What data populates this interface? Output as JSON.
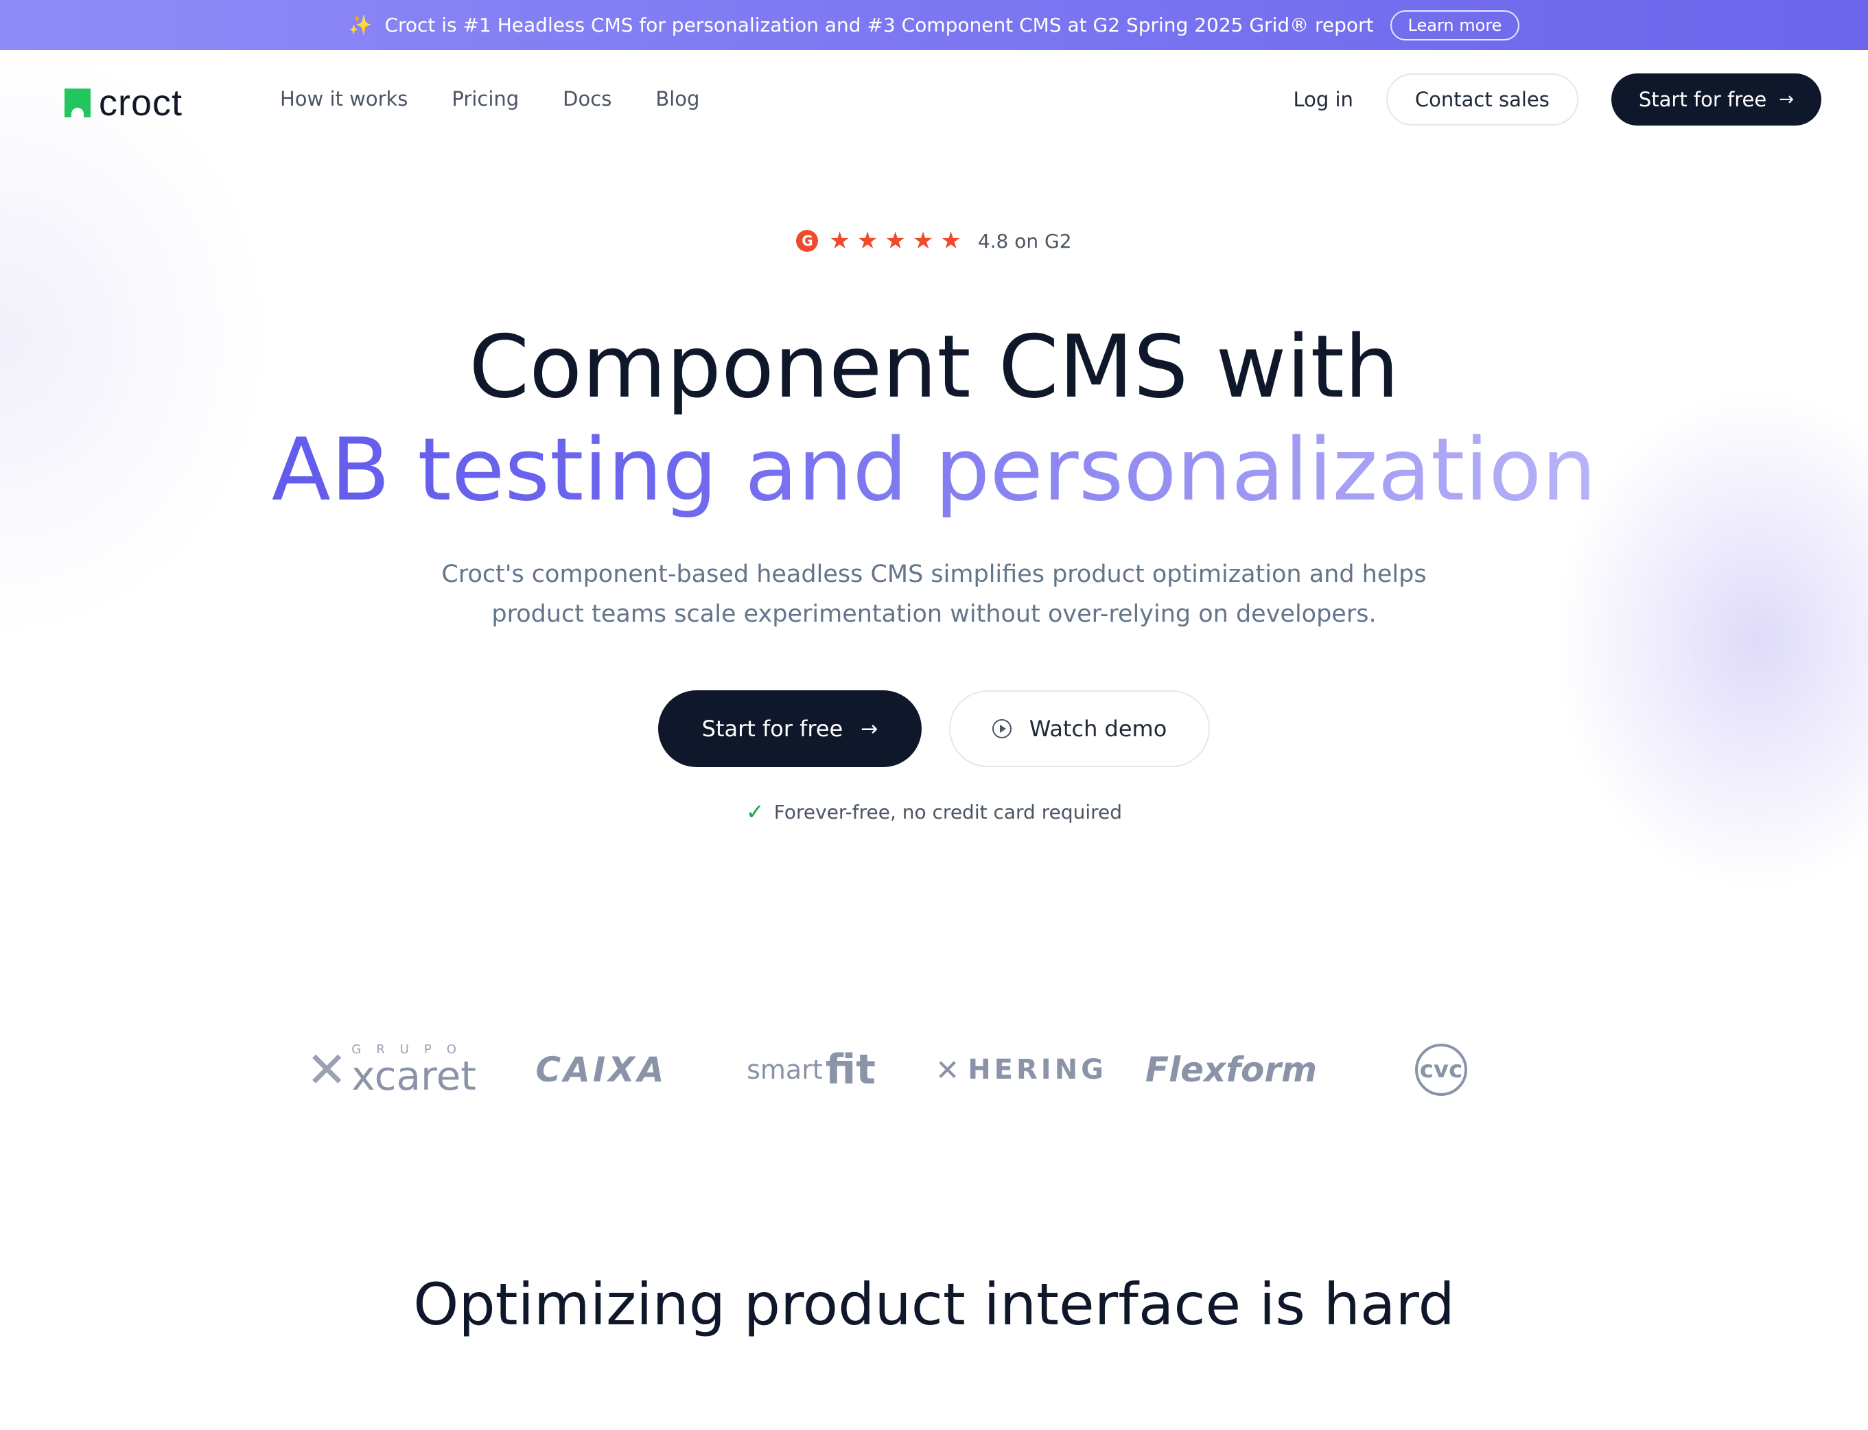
{
  "announcement": {
    "sparkle": "✨",
    "message": "Croct is #1 Headless CMS for personalization and #3 Component CMS at G2 Spring 2025 Grid® report",
    "cta": "Learn more"
  },
  "brand": {
    "name": "croct"
  },
  "nav": {
    "links": [
      "How it works",
      "Pricing",
      "Docs",
      "Blog"
    ],
    "login": "Log in",
    "contact": "Contact sales",
    "start": "Start for free"
  },
  "rating": {
    "g2_mark": "G",
    "stars": 5,
    "text": "4.8 on G2"
  },
  "hero": {
    "line1": "Component CMS with",
    "line2": "AB testing and personalization",
    "subtitle": "Croct's component-based headless CMS simplifies product optimization and helps product teams scale experimentation without over-relying on developers.",
    "primary_cta": "Start for free",
    "secondary_cta": "Watch demo",
    "note": "Forever-free, no credit card required"
  },
  "customer_logos": {
    "xcaret_grupo": "GRUPO",
    "xcaret_name": "xcaret",
    "caixa": "CAIXA",
    "smartfit_smart": "smart",
    "smartfit_fit": "fit",
    "hering": "HERING",
    "flexform": "Flexform",
    "cvc": "cvc"
  },
  "section": {
    "title": "Optimizing product interface is hard"
  },
  "colors": {
    "accent": "#6d66ee",
    "dark": "#0f172a",
    "brand_green": "#22c55e",
    "g2_red": "#ef4a2e"
  }
}
